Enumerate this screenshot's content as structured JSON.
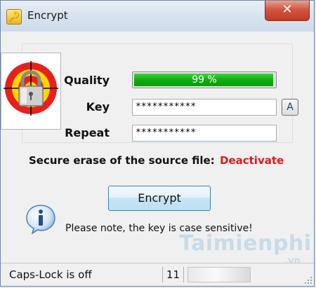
{
  "window": {
    "title": "Encrypt",
    "close_label": "✕"
  },
  "form": {
    "quality_label": "Quality",
    "quality_value": 99,
    "quality_text": "99 %",
    "key_label": "Key",
    "key_value": "***********",
    "repeat_label": "Repeat",
    "repeat_value": "***********",
    "case_button_label": "A"
  },
  "secure_erase": {
    "text": "Secure erase of the source file:",
    "link": "Deactivate",
    "link_color": "#e0191e"
  },
  "actions": {
    "encrypt_label": "Encrypt"
  },
  "note": {
    "text": "Please note, the key is case sensitive!"
  },
  "watermark": {
    "text": "Taimienphi",
    "sub": ".vn"
  },
  "status": {
    "caps_lock": "Caps-Lock is off",
    "count": "11"
  },
  "colors": {
    "progress": "#0fae0f",
    "accent": "#3c7fb1"
  }
}
